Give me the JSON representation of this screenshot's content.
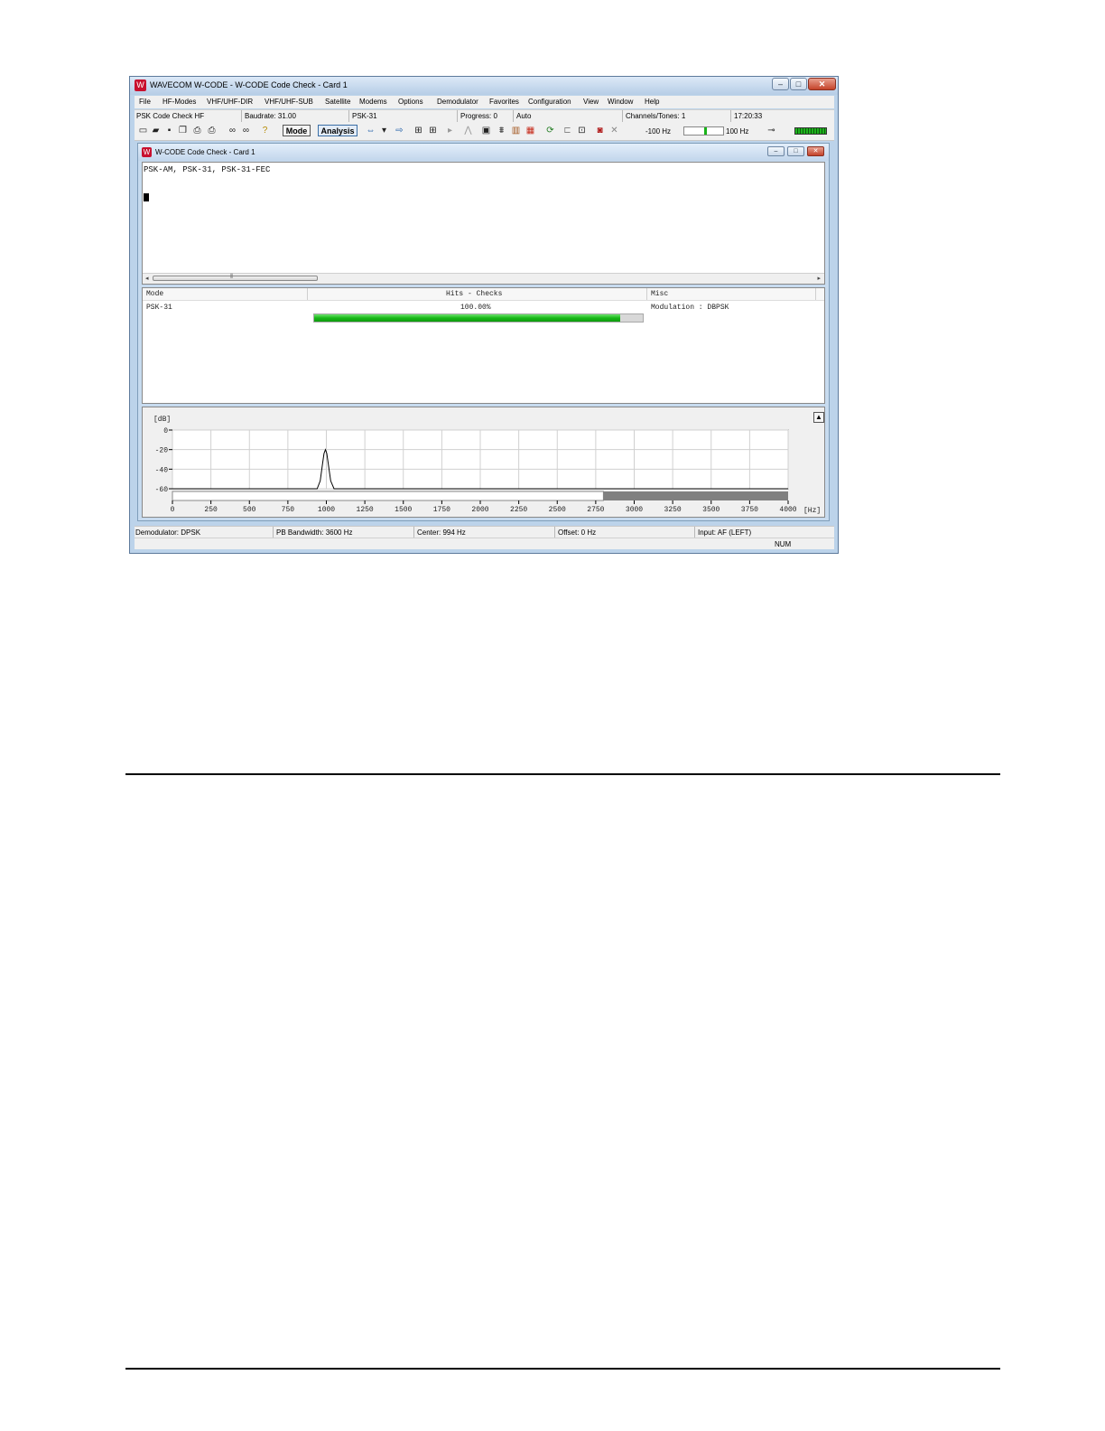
{
  "window": {
    "title": "WAVECOM W-CODE - W-CODE Code Check - Card 1",
    "controls": {
      "minimize": "–",
      "maximize": "□",
      "close": "✕"
    }
  },
  "menu": [
    "File",
    "HF-Modes",
    "VHF/UHF-DIR",
    "VHF/UHF-SUB",
    "Satellite",
    "Modems",
    "Options",
    "Demodulator",
    "Favorites",
    "Configuration",
    "View",
    "Window",
    "Help"
  ],
  "infobar": {
    "mode": "PSK Code Check HF",
    "baudrate": "Baudrate: 31.00",
    "submode": "PSK-31",
    "progress": "Progress: 0",
    "auto": "Auto",
    "channels": "Channels/Tones: 1",
    "time": "17:20:33"
  },
  "toolbar": {
    "mode_label": "Mode",
    "analysis_label": "Analysis",
    "freq_low": "-100 Hz",
    "freq_high": "100 Hz"
  },
  "child": {
    "title": "W-CODE Code Check - Card 1"
  },
  "output": {
    "mode_line": "PSK-AM, PSK-31, PSK-31-FEC"
  },
  "results": {
    "headers": {
      "mode": "Mode",
      "hits": "Hits - Checks",
      "misc": "Misc"
    },
    "rows": [
      {
        "mode": "PSK-31",
        "hits": "100.00%",
        "misc": "Modulation : DBPSK",
        "bar_fraction": 0.93
      }
    ]
  },
  "spectrum": {
    "y_unit": "[dB]",
    "x_unit": "[Hz]",
    "up_button": "▲"
  },
  "chart_data": {
    "type": "line",
    "xlabel": "[Hz]",
    "ylabel": "[dB]",
    "xlim": [
      0,
      4000
    ],
    "ylim": [
      -60,
      0
    ],
    "x_ticks": [
      0,
      250,
      500,
      750,
      1000,
      1250,
      1500,
      1750,
      2000,
      2250,
      2500,
      2750,
      3000,
      3250,
      3500,
      3750,
      4000
    ],
    "y_ticks": [
      0,
      -20,
      -40,
      -60
    ],
    "grid": true,
    "series": [
      {
        "x": [
          0,
          900,
          940,
          960,
          975,
          985,
          994,
          1003,
          1013,
          1028,
          1050,
          1100,
          4000
        ],
        "y": [
          -61,
          -61,
          -60,
          -52,
          -35,
          -24,
          -20,
          -24,
          -35,
          -52,
          -60,
          -61,
          -61
        ]
      }
    ],
    "passband": {
      "start": 0,
      "end": 2800
    },
    "colors": {
      "line": "#000000",
      "grid": "#d0d0d0",
      "passband": "#ffffff",
      "stopband": "#808080"
    }
  },
  "status": {
    "demodulator": "Demodulator: DPSK",
    "bandwidth": "PB Bandwidth: 3600 Hz",
    "center": "Center: 994 Hz",
    "offset": "Offset: 0 Hz",
    "input": "Input: AF (LEFT)",
    "num": "NUM"
  },
  "icons": [
    "new-file-icon",
    "open-folder-icon",
    "save-icon",
    "copy-icon",
    "print-preview-icon",
    "print-icon",
    "find-icon",
    "find-next-icon",
    "help-icon",
    "arrow-left-right-icon",
    "dropdown-icon",
    "arrow-right-icon",
    "code-check-icon",
    "code-check-2-icon",
    "play-icon",
    "trace-icon",
    "card-icon",
    "binoculars-icon",
    "bars-icon",
    "colorful-icon",
    "refresh-icon",
    "split-icon",
    "ps-icon",
    "record-icon",
    "cancel-icon",
    "tune-icon"
  ]
}
